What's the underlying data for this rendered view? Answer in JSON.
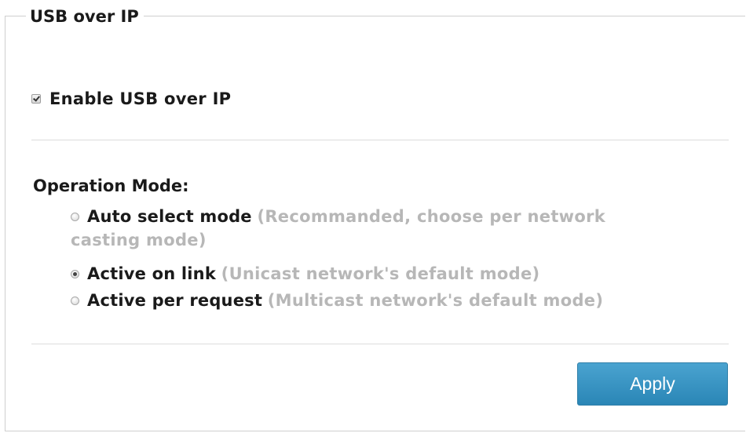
{
  "panel": {
    "title": "USB over IP"
  },
  "enable": {
    "label": "Enable USB over IP",
    "checked": true
  },
  "operation_mode": {
    "label": "Operation Mode:",
    "options": [
      {
        "label": "Auto select mode",
        "hint": "(Recommanded, choose per network casting mode)",
        "selected": false
      },
      {
        "label": "Active on link",
        "hint": "(Unicast network's default mode)",
        "selected": true
      },
      {
        "label": "Active per request",
        "hint": "(Multicast network's default mode)",
        "selected": false
      }
    ]
  },
  "actions": {
    "apply_label": "Apply"
  },
  "colors": {
    "button_top": "#4aa3d0",
    "button_bottom": "#2a86b6",
    "hint_text": "#b7b7b7",
    "border": "#cfcfcf"
  }
}
